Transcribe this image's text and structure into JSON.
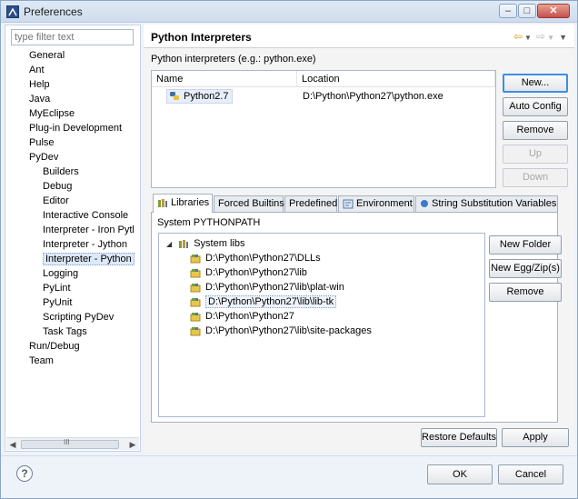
{
  "window": {
    "title": "Preferences"
  },
  "filter": {
    "placeholder": "type filter text"
  },
  "nav_tree": [
    {
      "label": "General",
      "level": 0
    },
    {
      "label": "Ant",
      "level": 0
    },
    {
      "label": "Help",
      "level": 0
    },
    {
      "label": "Java",
      "level": 0
    },
    {
      "label": "MyEclipse",
      "level": 0
    },
    {
      "label": "Plug-in Development",
      "level": 0
    },
    {
      "label": "Pulse",
      "level": 0
    },
    {
      "label": "PyDev",
      "level": 0
    },
    {
      "label": "Builders",
      "level": 1
    },
    {
      "label": "Debug",
      "level": 1
    },
    {
      "label": "Editor",
      "level": 1
    },
    {
      "label": "Interactive Console",
      "level": 1
    },
    {
      "label": "Interpreter - Iron Pytl",
      "level": 1
    },
    {
      "label": "Interpreter - Jython",
      "level": 1
    },
    {
      "label": "Interpreter - Python",
      "level": 1,
      "selected": true
    },
    {
      "label": "Logging",
      "level": 1
    },
    {
      "label": "PyLint",
      "level": 1
    },
    {
      "label": "PyUnit",
      "level": 1
    },
    {
      "label": "Scripting PyDev",
      "level": 1
    },
    {
      "label": "Task Tags",
      "level": 1
    },
    {
      "label": "Run/Debug",
      "level": 0
    },
    {
      "label": "Team",
      "level": 0
    }
  ],
  "page": {
    "title": "Python Interpreters",
    "interpreters_label": "Python interpreters (e.g.: python.exe)"
  },
  "table": {
    "headers": [
      "Name",
      "Location"
    ],
    "rows": [
      {
        "name": "Python2.7",
        "location": "D:\\Python\\Python27\\python.exe"
      }
    ]
  },
  "side_buttons": [
    {
      "label": "New...",
      "enabled": true
    },
    {
      "label": "Auto Config",
      "enabled": true
    },
    {
      "label": "Remove",
      "enabled": true
    },
    {
      "label": "Up",
      "enabled": false
    },
    {
      "label": "Down",
      "enabled": false
    }
  ],
  "tabs": [
    "Libraries",
    "Forced Builtins",
    "Predefined",
    "Environment",
    "String Substitution Variables"
  ],
  "libraries": {
    "section_label": "System PYTHONPATH",
    "root": "System libs",
    "paths": [
      "D:\\Python\\Python27\\DLLs",
      "D:\\Python\\Python27\\lib",
      "D:\\Python\\Python27\\lib\\plat-win",
      "D:\\Python\\Python27\\lib\\lib-tk",
      "D:\\Python\\Python27",
      "D:\\Python\\Python27\\lib\\site-packages"
    ],
    "buttons": [
      "New Folder",
      "New Egg/Zip(s)",
      "Remove"
    ]
  },
  "page_buttons": {
    "restore": "Restore Defaults",
    "apply": "Apply"
  },
  "dialog_buttons": {
    "ok": "OK",
    "cancel": "Cancel"
  },
  "scroll_mid": "III"
}
